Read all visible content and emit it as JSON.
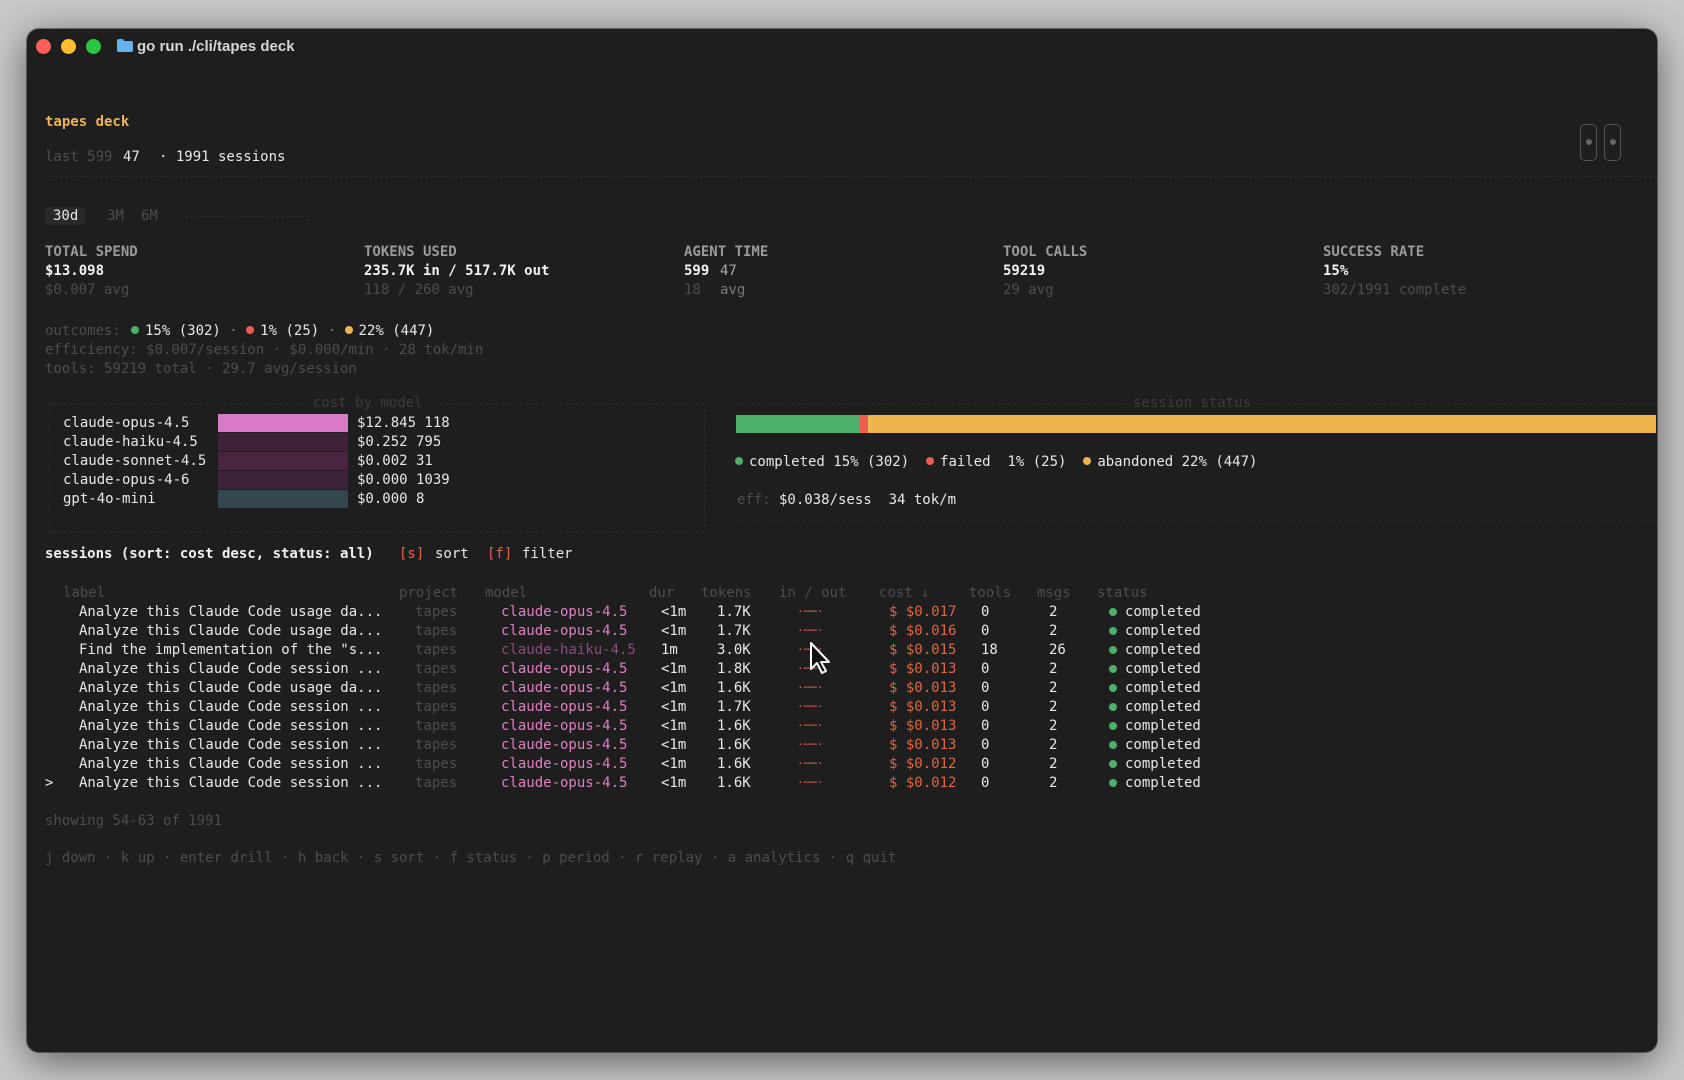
{
  "window": {
    "title": "go run ./cli/tapes deck"
  },
  "header": {
    "app_name": "tapes deck",
    "subtitle_prefix": "last 599",
    "subtitle_count": "47",
    "subtitle_sessions": "· 1991 sessions"
  },
  "periods": {
    "items": [
      "30d",
      "3M",
      "6M"
    ],
    "selected": "30d"
  },
  "metrics": [
    {
      "label": "TOTAL SPEND",
      "value": "$13.098",
      "sub_a": "$0.007 avg",
      "sub_b": ""
    },
    {
      "label": "TOKENS USED",
      "value": "235.7K in / 517.7K out",
      "sub_a": "118 / 260 avg",
      "sub_b": ""
    },
    {
      "label": "AGENT TIME",
      "value": "599",
      "value_extra": "47",
      "sub_a": "18",
      "sub_b": "avg"
    },
    {
      "label": "TOOL CALLS",
      "value": "59219",
      "sub_a": "29 avg",
      "sub_b": ""
    },
    {
      "label": "SUCCESS RATE",
      "value": "15%",
      "sub_a": "302/1991 complete",
      "sub_b": ""
    }
  ],
  "summary": {
    "outcomes_label": "outcomes:",
    "outcome_completed": "15% (302)",
    "outcome_failed": "1% (25)",
    "outcome_abandoned": "22% (447)",
    "sep": "·",
    "efficiency": "efficiency: $0.007/session · $0.000/min · 28 tok/min",
    "tools": "tools: 59219 total · 29.7 avg/session"
  },
  "cost_by_model": {
    "title": "cost by model",
    "rows": [
      {
        "model": "claude-opus-4.5",
        "value": "$12.845 118",
        "color": "#d97ac8",
        "share": 1.0
      },
      {
        "model": "claude-haiku-4.5",
        "value": "$0.252 795",
        "color": "#3d2335",
        "share": 1.0
      },
      {
        "model": "claude-sonnet-4.5",
        "value": "$0.002 31",
        "color": "#4a2540",
        "share": 1.0
      },
      {
        "model": "claude-opus-4-6",
        "value": "$0.000 1039",
        "color": "#3e2238",
        "share": 1.0
      },
      {
        "model": "gpt-4o-mini",
        "value": "$0.000 8",
        "color": "#33474f",
        "share": 1.0
      }
    ]
  },
  "session_status": {
    "title": "session status",
    "completed_share": 0.15,
    "failed_share": 0.01,
    "abandoned_share": 0.84,
    "colors": {
      "completed": "#4caf6a",
      "failed": "#ee5e4e",
      "abandoned": "#f0b44e"
    },
    "legend_completed": "completed 15% (302)",
    "legend_failed": "failed  1% (25)",
    "legend_abandoned": "abandoned 22% (447)",
    "eff_label": "eff:",
    "eff_value": "$0.038/sess  34 tok/m"
  },
  "sessions": {
    "heading": "sessions (sort: cost desc, status: all)",
    "sort_key": "[s]",
    "sort_label": "sort",
    "filter_key": "[f]",
    "filter_label": "filter",
    "columns": [
      "label",
      "project",
      "model",
      "dur",
      "tokens",
      "in / out",
      "cost ↓",
      "tools",
      "msgs",
      "status"
    ],
    "rows": [
      {
        "label": "Analyze this Claude Code usage da...",
        "project": "tapes",
        "model": "claude-opus-4.5",
        "dur": "<1m",
        "tokens": "1.7K",
        "io": "·──·",
        "cost": "$ $0.017",
        "tools": "0",
        "msgs": "2",
        "status": "completed",
        "model_dim": false
      },
      {
        "label": "Analyze this Claude Code usage da...",
        "project": "tapes",
        "model": "claude-opus-4.5",
        "dur": "<1m",
        "tokens": "1.7K",
        "io": "·──·",
        "cost": "$ $0.016",
        "tools": "0",
        "msgs": "2",
        "status": "completed",
        "model_dim": false
      },
      {
        "label": "Find the implementation of the \"s...",
        "project": "tapes",
        "model": "claude-haiku-4.5",
        "dur": "1m",
        "tokens": "3.0K",
        "io": "·──·",
        "cost": "$ $0.015",
        "tools": "18",
        "msgs": "26",
        "status": "completed",
        "model_dim": true
      },
      {
        "label": "Analyze this Claude Code session ...",
        "project": "tapes",
        "model": "claude-opus-4.5",
        "dur": "<1m",
        "tokens": "1.8K",
        "io": "·──·",
        "cost": "$ $0.013",
        "tools": "0",
        "msgs": "2",
        "status": "completed",
        "model_dim": false
      },
      {
        "label": "Analyze this Claude Code usage da...",
        "project": "tapes",
        "model": "claude-opus-4.5",
        "dur": "<1m",
        "tokens": "1.6K",
        "io": "·──·",
        "cost": "$ $0.013",
        "tools": "0",
        "msgs": "2",
        "status": "completed",
        "model_dim": false
      },
      {
        "label": "Analyze this Claude Code session ...",
        "project": "tapes",
        "model": "claude-opus-4.5",
        "dur": "<1m",
        "tokens": "1.7K",
        "io": "·──·",
        "cost": "$ $0.013",
        "tools": "0",
        "msgs": "2",
        "status": "completed",
        "model_dim": false
      },
      {
        "label": "Analyze this Claude Code session ...",
        "project": "tapes",
        "model": "claude-opus-4.5",
        "dur": "<1m",
        "tokens": "1.6K",
        "io": "·──·",
        "cost": "$ $0.013",
        "tools": "0",
        "msgs": "2",
        "status": "completed",
        "model_dim": false
      },
      {
        "label": "Analyze this Claude Code session ...",
        "project": "tapes",
        "model": "claude-opus-4.5",
        "dur": "<1m",
        "tokens": "1.6K",
        "io": "·──·",
        "cost": "$ $0.013",
        "tools": "0",
        "msgs": "2",
        "status": "completed",
        "model_dim": false
      },
      {
        "label": "Analyze this Claude Code session ...",
        "project": "tapes",
        "model": "claude-opus-4.5",
        "dur": "<1m",
        "tokens": "1.6K",
        "io": "·──·",
        "cost": "$ $0.012",
        "tools": "0",
        "msgs": "2",
        "status": "completed",
        "model_dim": false
      },
      {
        "label": "Analyze this Claude Code session ...",
        "project": "tapes",
        "model": "claude-opus-4.5",
        "dur": "<1m",
        "tokens": "1.6K",
        "io": "·──·",
        "cost": "$ $0.012",
        "tools": "0",
        "msgs": "2",
        "status": "completed",
        "model_dim": false
      }
    ],
    "selected_marker": ">",
    "selected_index": 9
  },
  "footer": {
    "showing": "showing 54-63 of 1991",
    "keys": "j down · k up · enter drill · h back · s sort · f status · p period · r replay · a analytics · q quit"
  }
}
